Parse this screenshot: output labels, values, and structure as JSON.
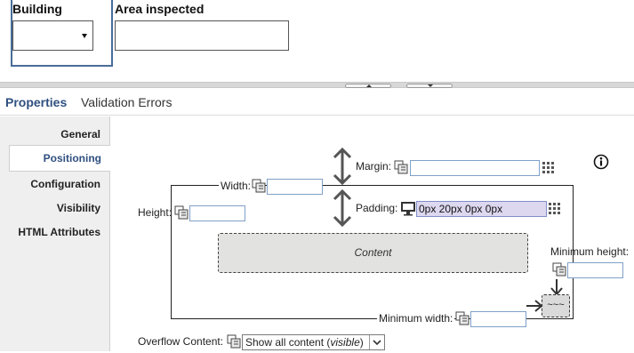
{
  "form": {
    "building": {
      "label": "Building",
      "value": ""
    },
    "area": {
      "label": "Area inspected",
      "value": ""
    }
  },
  "tabs": [
    {
      "label": "Properties",
      "active": true
    },
    {
      "label": "Validation Errors",
      "active": false
    }
  ],
  "nav": [
    {
      "label": "General",
      "active": false
    },
    {
      "label": "Positioning",
      "active": true
    },
    {
      "label": "Configuration",
      "active": false
    },
    {
      "label": "Visibility",
      "active": false
    },
    {
      "label": "HTML Attributes",
      "active": false
    }
  ],
  "positioning": {
    "margin": {
      "label": "Margin:",
      "value": ""
    },
    "padding": {
      "label": "Padding:",
      "value": "0px 20px 0px 0px"
    },
    "width": {
      "label": "Width:",
      "value": ""
    },
    "height": {
      "label": "Height:",
      "value": ""
    },
    "content_label": "Content",
    "min_height": {
      "label": "Minimum height:",
      "value": ""
    },
    "min_width": {
      "label": "Minimum width:",
      "value": ""
    },
    "min_box_glyph": "~~~",
    "overflow": {
      "label": "Overflow Content:",
      "value_prefix": "Show all content (",
      "value_em": "visible",
      "value_suffix": ")"
    }
  },
  "icons": {
    "link": "link-chain-icon",
    "grid": "grid-picker-icon",
    "info": "info-icon",
    "monitor": "monitor-icon"
  },
  "colors": {
    "accent": "#2f4f7f",
    "input_border": "#7fa0c8",
    "filled_input": "#ddd8f0",
    "content_fill": "#e2e2e0"
  }
}
